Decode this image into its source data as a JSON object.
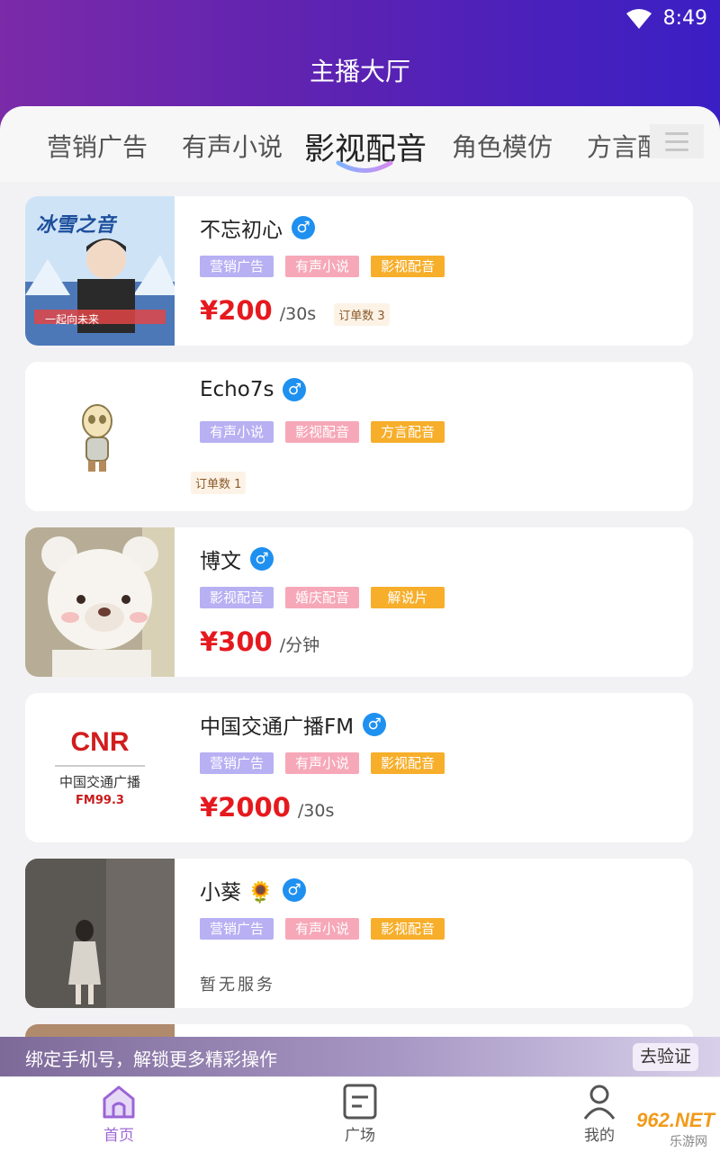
{
  "status": {
    "time": "8:49"
  },
  "header": {
    "title": "主播大厅"
  },
  "tabs": [
    "营销广告",
    "有声小说",
    "影视配音",
    "角色模仿",
    "方言配"
  ],
  "cards": [
    {
      "name": "不忘初心",
      "tags": [
        "营销广告",
        "有声小说",
        "影视配音"
      ],
      "price": "¥200",
      "unit": "/30s",
      "orders": "订单数 3",
      "thumb": {
        "poster_title": "冰雪之音",
        "poster_caption": "一起向未来"
      }
    },
    {
      "name": "Echo7s",
      "tags": [
        "有声小说",
        "影视配音",
        "方言配音"
      ],
      "orders": "订单数 1"
    },
    {
      "name": "博文",
      "tags": [
        "影视配音",
        "婚庆配音",
        "解说片"
      ],
      "price": "¥300",
      "unit": "/分钟"
    },
    {
      "name": "中国交通广播FM",
      "tags": [
        "营销广告",
        "有声小说",
        "影视配音"
      ],
      "price": "¥2000",
      "unit": "/30s",
      "thumb": {
        "logo": "CNR",
        "sub": "中国交通广播",
        "fm": "FM99.3"
      }
    },
    {
      "name": "小葵 🌻",
      "tags": [
        "营销广告",
        "有声小说",
        "影视配音"
      ],
      "noservice": "暂无服务"
    }
  ],
  "icons": {
    "gender": "male-icon",
    "wifi": "wifi-icon",
    "menu": "menu-icon"
  },
  "banner": {
    "text": "绑定手机号，解锁更多精彩操作",
    "button": "去验证"
  },
  "nav": [
    {
      "label": "首页",
      "icon": "home-icon",
      "active": true
    },
    {
      "label": "广场",
      "icon": "square-icon",
      "active": false
    },
    {
      "label": "我的",
      "icon": "user-icon",
      "active": false
    }
  ],
  "watermark": {
    "text": "962.NET",
    "sub": "乐游网"
  },
  "colors": {
    "accent": "#a068d6",
    "price": "#e5191e",
    "tag_purple": "#b7b0f3",
    "tag_pink": "#f6a8b8",
    "tag_orange": "#f7ae2a",
    "header_start": "#7b2aa8",
    "header_end": "#3a1fc4"
  }
}
